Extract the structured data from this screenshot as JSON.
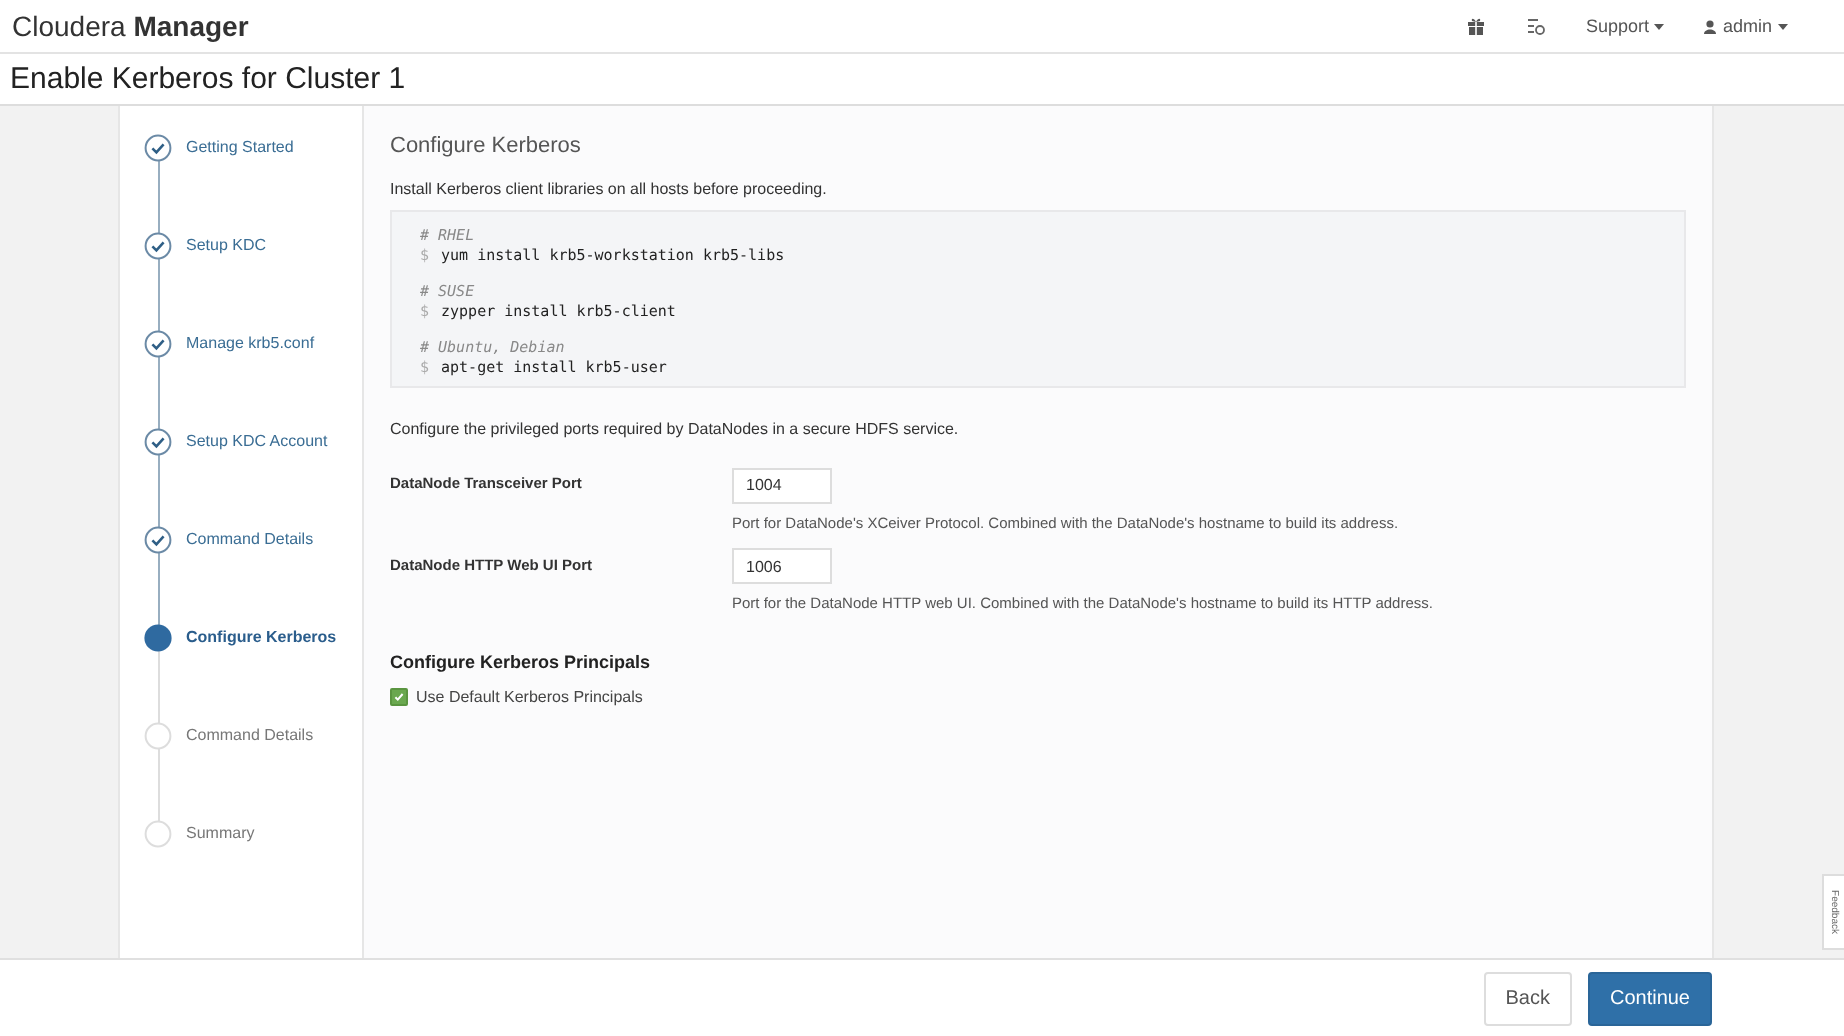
{
  "navbar": {
    "brand_light": "Cloudera",
    "brand_bold": "Manager",
    "menus": [
      {
        "kind": "icon"
      },
      {
        "kind": "icon"
      },
      {
        "kind": "dropdown",
        "label": "Support"
      },
      {
        "kind": "user",
        "label": "admin"
      }
    ]
  },
  "page_title": "Enable Kerberos for Cluster 1",
  "steps": [
    {
      "label": "Getting Started",
      "completed": true,
      "selected": false
    },
    {
      "label": "Setup KDC",
      "completed": true,
      "selected": false
    },
    {
      "label": "Manage krb5.conf",
      "completed": true,
      "selected": false
    },
    {
      "label": "Setup KDC Account",
      "completed": true,
      "selected": false
    },
    {
      "label": "Command Details",
      "completed": true,
      "selected": false
    },
    {
      "label": "Configure Kerberos",
      "completed": false,
      "selected": true
    },
    {
      "label": "Command Details",
      "completed": false,
      "selected": false
    },
    {
      "label": "Summary",
      "completed": false,
      "selected": false
    }
  ],
  "section_title": "Configure Kerberos",
  "intro": "Install Kerberos client libraries on all hosts before proceeding.",
  "code_sections": [
    {
      "comment": "# RHEL",
      "prompt": "$",
      "command": "yum install krb5-workstation krb5-libs"
    },
    {
      "comment": "# SUSE",
      "prompt": "$",
      "command": "zypper install krb5-client"
    },
    {
      "comment": "# Ubuntu, Debian",
      "prompt": "$",
      "command": "apt-get install krb5-user"
    }
  ],
  "ports_intro": "Configure the privileged ports required by DataNodes in a secure HDFS service.",
  "fields": [
    {
      "label": "DataNode Transceiver Port",
      "value": "1004",
      "help": "Port for DataNode's XCeiver Protocol. Combined with the DataNode's hostname to build its address."
    },
    {
      "label": "DataNode HTTP Web UI Port",
      "value": "1006",
      "help": "Port for the DataNode HTTP web UI. Combined with the DataNode's hostname to build its HTTP address."
    }
  ],
  "principals_title": "Configure Kerberos Principals",
  "principals_checkbox": {
    "label": "Use Default Kerberos Principals",
    "checked": true
  },
  "feedback_tab": "Feedback",
  "buttons": [
    {
      "label": "Back",
      "kind": "default"
    },
    {
      "label": "Continue",
      "kind": "primary"
    }
  ]
}
